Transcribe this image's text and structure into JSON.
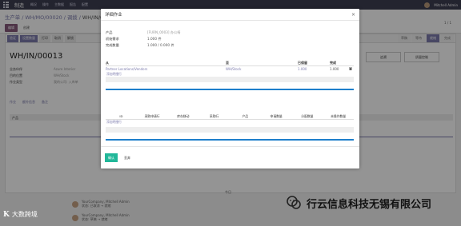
{
  "topbar": {
    "brand": "制造",
    "menu": [
      "概况",
      "操作",
      "主数据",
      "报告",
      "配置"
    ],
    "user": "Mitchell Admin"
  },
  "breadcrumb": {
    "parts": [
      "生产单",
      "WH/MO/00020",
      "调拨"
    ],
    "current": "WH/IN/00013"
  },
  "toolbar": {
    "edit_label": "编辑",
    "create_label": "创建",
    "pager": "1 / 1"
  },
  "statusbar": {
    "buttons": [
      "验证",
      "设置数量",
      "打印",
      "取消",
      "解锁"
    ],
    "stages": [
      "草稿",
      "等待",
      "就绪",
      "完成"
    ],
    "active_stage": "就绪"
  },
  "form": {
    "name": "WH/IN/00013",
    "fields": [
      {
        "label": "业务伙伴",
        "value": "Azure Interior"
      },
      {
        "label": "目的位置",
        "value": "WH/Stock"
      },
      {
        "label": "作业类型",
        "value": "我的公司: 入库单"
      }
    ],
    "smart_buttons": [
      "追溯",
      "质量控制"
    ],
    "tabs": [
      "作业",
      "额外信息",
      "备注"
    ],
    "table_header": "产品"
  },
  "chatter": {
    "today": "今日",
    "messages": [
      {
        "author": "YourCompany, Mitchell Admin",
        "text": "状态: 已取消 → 就绪"
      },
      {
        "author": "YourCompany, Mitchell Admin",
        "text": "状态: 草稿 → 就绪"
      }
    ]
  },
  "modal": {
    "title": "详细作业",
    "close": "×",
    "product_label": "产品",
    "product_value": "[FURN_0003] 办公椅",
    "sn_label": "初始需求",
    "sn_value": "1.000 件",
    "qty_label": "完成数量",
    "qty_value": "1.000 / 0.000 件",
    "move_columns": [
      "从",
      "至",
      "已保留",
      "完成"
    ],
    "move_row": {
      "from": "Partner Locations/Vendors",
      "to": "WH/Stock",
      "reserved": "1.000",
      "done": "1.000"
    },
    "add_line": "添加明细行",
    "sn_columns": [
      "ID",
      "采购申请行",
      "库存移动",
      "采购行",
      "产品",
      "申请数量",
      "分配数量",
      "未操作数量"
    ],
    "add_line2": "添加明细行",
    "confirm_label": "确认",
    "discard_label": "丢弃"
  },
  "watermarks": {
    "left": "大数跨境",
    "right": "行云信息科技无锡有限公司"
  },
  "colors": {
    "navbar": "#3d3e52",
    "accent": "#7c7bad",
    "confirm": "#21b799",
    "progress_line": "#1e7fcb"
  }
}
